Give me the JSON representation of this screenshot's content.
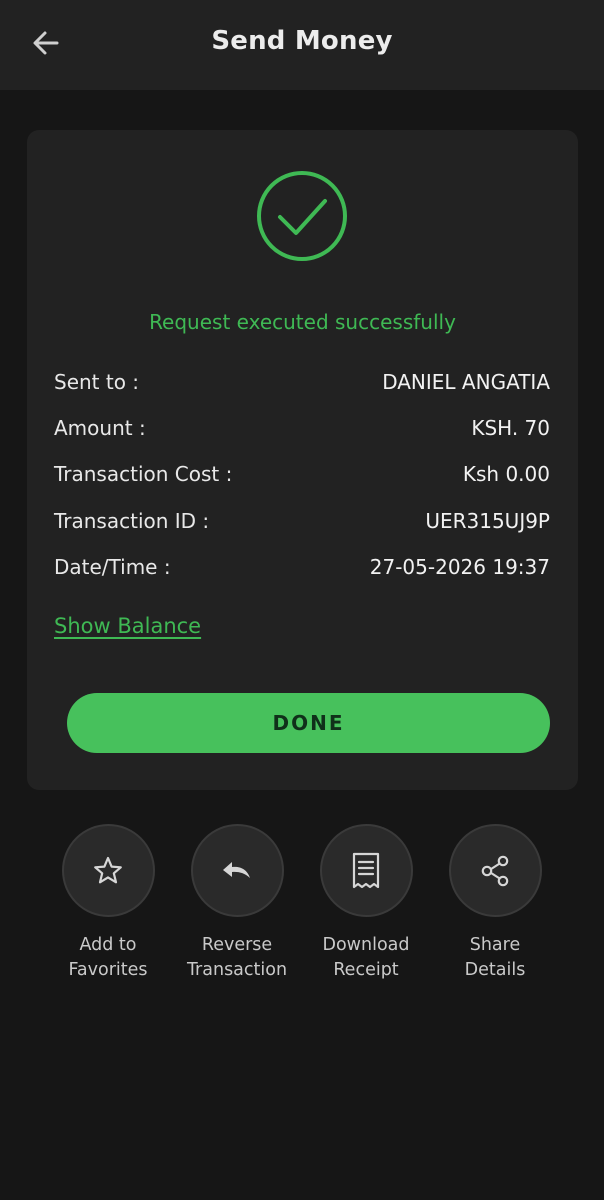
{
  "header": {
    "title": "Send Money",
    "back_icon": "arrow-left-icon"
  },
  "result": {
    "icon": "check-circle-icon",
    "status_text": "Request executed successfully",
    "status_color": "#3fb954"
  },
  "details": [
    {
      "label": "Sent to :",
      "value": "DANIEL ANGATIA"
    },
    {
      "label": "Amount :",
      "value": "KSH. 70"
    },
    {
      "label": "Transaction Cost :",
      "value": "Ksh 0.00"
    },
    {
      "label": "Transaction ID :",
      "value": "UER315UJ9P"
    },
    {
      "label": "Date/Time :",
      "value": "27-05-2026 19:37"
    }
  ],
  "show_balance_label": "Show Balance",
  "done_label": "DONE",
  "accent_color": "#47c15c",
  "actions": [
    {
      "icon": "star-icon",
      "line1": "Add to",
      "line2": "Favorites"
    },
    {
      "icon": "undo-icon",
      "line1": "Reverse",
      "line2": "Transaction"
    },
    {
      "icon": "receipt-icon",
      "line1": "Download",
      "line2": "Receipt"
    },
    {
      "icon": "share-icon",
      "line1": "Share",
      "line2": "Details"
    }
  ]
}
